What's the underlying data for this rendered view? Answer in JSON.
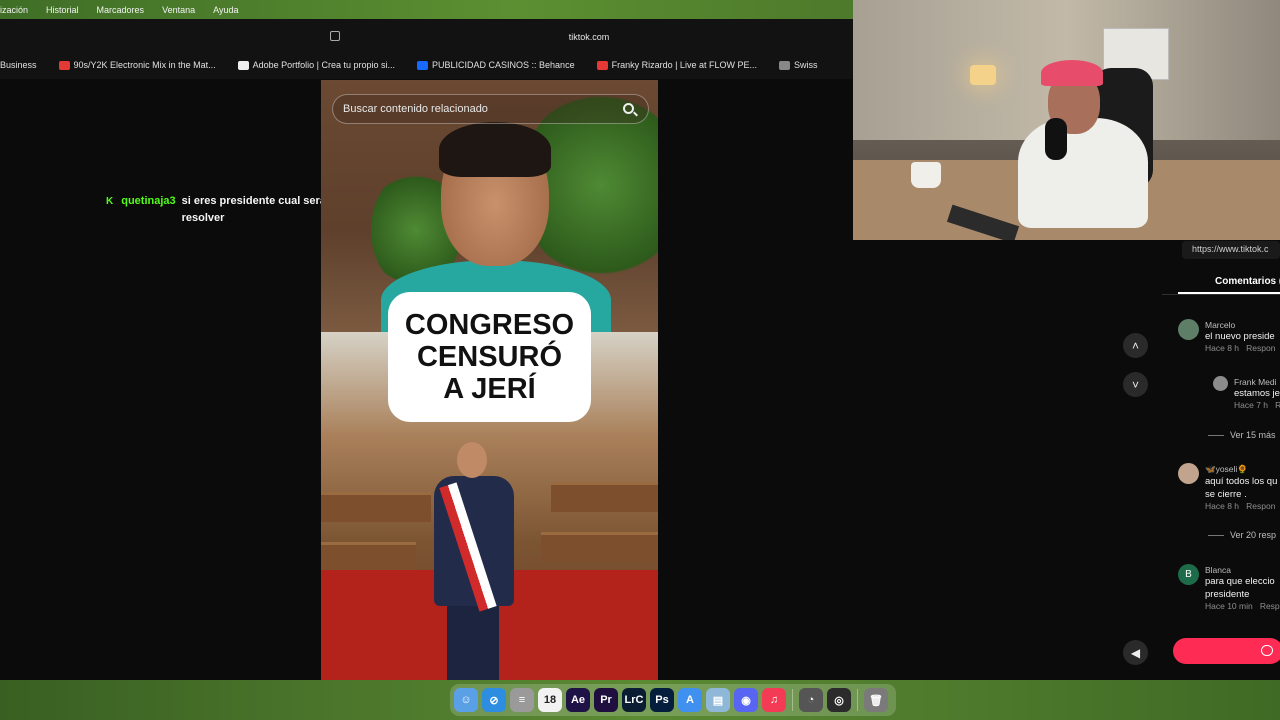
{
  "menubar": {
    "items": [
      "ización",
      "Historial",
      "Marcadores",
      "Ventana",
      "Ayuda"
    ]
  },
  "browser": {
    "url": "tiktok.com",
    "bookmarks": [
      {
        "label": "Business",
        "color": "#e8e8e8"
      },
      {
        "label": "90s/Y2K Electronic Mix in the Mat...",
        "color": "#e53935"
      },
      {
        "label": "Adobe Portfolio | Crea tu propio si...",
        "color": "#eeeeee"
      },
      {
        "label": "PUBLICIDAD CASINOS :: Behance",
        "color": "#1769ff"
      },
      {
        "label": "Franky Rizardo | Live at FLOW PE...",
        "color": "#e53935"
      },
      {
        "label": "Swiss",
        "color": "#888888"
      }
    ]
  },
  "chat": {
    "user": "quetinaja3",
    "message": "si eres presidente cual será tu primera duda en resolver"
  },
  "video": {
    "search_placeholder": "Buscar contenido relacionado",
    "overlay": [
      "CONGRESO",
      "CENSURÓ",
      "A JERÍ"
    ]
  },
  "panel": {
    "link_tooltip": "https://www.tiktok.c",
    "comments_tab": "Comentarios (",
    "comments": [
      {
        "name": "Marcelo",
        "text": "el nuevo preside",
        "meta": "Hace 8 h",
        "reply": "Respon"
      },
      {
        "name": "Frank Medi",
        "text": "estamos je",
        "meta": "Hace 7 h",
        "reply": "R"
      },
      {
        "name": "🦋yoseli🌻",
        "text": "aquí todos los qu",
        "text2": "se cierre .",
        "meta": "Hace 8 h",
        "reply": "Respon"
      },
      {
        "name": "Blanca",
        "initial": "B",
        "text": "para que eleccio",
        "text2": "presidente",
        "meta": "Hace 10 min",
        "reply": "Resp"
      }
    ],
    "more_replies": [
      "Ver 15 más",
      "Ver 20 resp"
    ]
  },
  "dock": {
    "apps": [
      {
        "name": "finder-icon",
        "label": "☺",
        "color": "#5aa0e6"
      },
      {
        "name": "safari-icon",
        "label": "⊘",
        "color": "#2d8de0"
      },
      {
        "name": "notes-icon",
        "label": "≡",
        "color": "#9a9a9a"
      },
      {
        "name": "calendar-icon",
        "label": "18",
        "color": "#f2f2f2"
      },
      {
        "name": "after-effects-icon",
        "label": "Ae",
        "color": "#1f1247"
      },
      {
        "name": "premiere-icon",
        "label": "Pr",
        "color": "#1f0f3f"
      },
      {
        "name": "lightroom-classic-icon",
        "label": "LrC",
        "color": "#0a1d33"
      },
      {
        "name": "photoshop-icon",
        "label": "Ps",
        "color": "#061e3d"
      },
      {
        "name": "app-store-icon",
        "label": "A",
        "color": "#3f90ef"
      },
      {
        "name": "preview-icon",
        "label": "▤",
        "color": "#8fb8d8"
      },
      {
        "name": "discord-icon",
        "label": "◉",
        "color": "#5865f2"
      },
      {
        "name": "music-icon",
        "label": "♫",
        "color": "#f43b55"
      },
      {
        "name": "activity-icon",
        "label": "◔",
        "color": "#555555"
      },
      {
        "name": "obs-icon",
        "label": "◎",
        "color": "#2b2b2b"
      },
      {
        "name": "trash-icon",
        "label": "🗑",
        "color": "#7a7a7a"
      }
    ]
  }
}
